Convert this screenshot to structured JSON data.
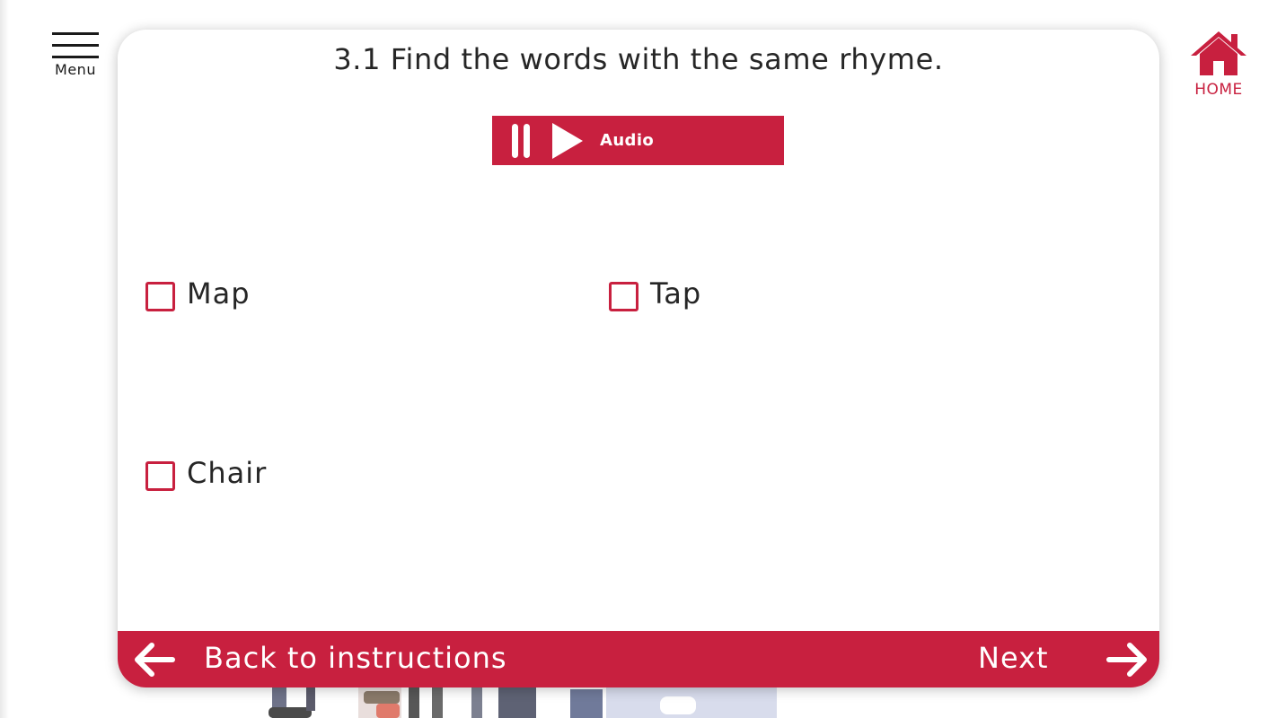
{
  "colors": {
    "accent": "#c8203f",
    "text": "#262626",
    "background": "#ffffff"
  },
  "header": {
    "menu_label": "Menu",
    "menu_icon": "hamburger-menu-icon",
    "home_label": "HOME",
    "home_icon": "home-icon"
  },
  "question": {
    "title": "3.1 Find the words with the same rhyme."
  },
  "audio": {
    "label": "Audio",
    "pause_icon": "pause-icon",
    "play_icon": "play-icon"
  },
  "options": [
    {
      "label": "Map",
      "checked": false
    },
    {
      "label": "Tap",
      "checked": false
    },
    {
      "label": "Chair",
      "checked": false
    }
  ],
  "footer": {
    "back_label": "Back to instructions",
    "back_icon": "arrow-left-icon",
    "next_label": "Next",
    "next_icon": "arrow-right-icon"
  }
}
